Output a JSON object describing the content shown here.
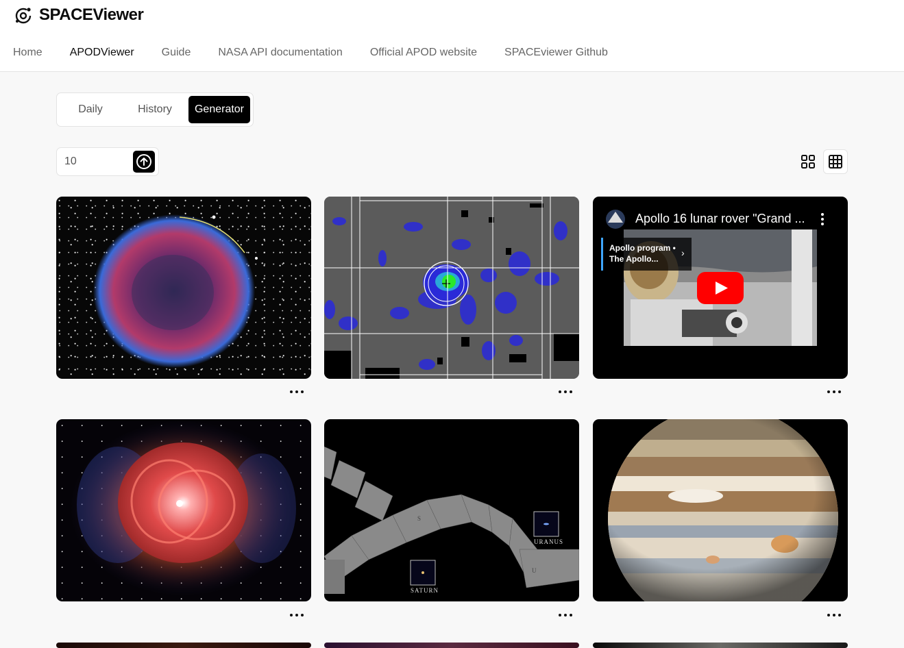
{
  "brand": {
    "name": "SPACEViewer"
  },
  "nav": [
    {
      "label": "Home",
      "active": false
    },
    {
      "label": "APODViewer",
      "active": true
    },
    {
      "label": "Guide",
      "active": false
    },
    {
      "label": "NASA API documentation",
      "active": false
    },
    {
      "label": "Official APOD website",
      "active": false
    },
    {
      "label": "SPACEviewer Github",
      "active": false
    }
  ],
  "tabs": [
    {
      "label": "Daily",
      "active": false
    },
    {
      "label": "History",
      "active": false
    },
    {
      "label": "Generator",
      "active": true
    }
  ],
  "generator": {
    "count_value": "10"
  },
  "video_card": {
    "title": "Apollo 16 lunar rover \"Grand ...",
    "playlist_line1": "Apollo program •",
    "playlist_line2": "The Apollo..."
  },
  "gallery_labels": {
    "saturn": "SATURN",
    "uranus": "URANUS",
    "s_marker": "S",
    "u_marker": "U"
  },
  "colors": {
    "accent": "#000000",
    "youtube_red": "#ff0000",
    "page_bg": "#f8f8f8"
  },
  "icons": {
    "brand": "orbit-logo-icon",
    "submit": "arrow-up-circle-icon",
    "grid_large": "grid-2x2-icon",
    "grid_small": "grid-3x3-icon",
    "more": "more-horizontal-icon",
    "play": "youtube-play-icon"
  }
}
